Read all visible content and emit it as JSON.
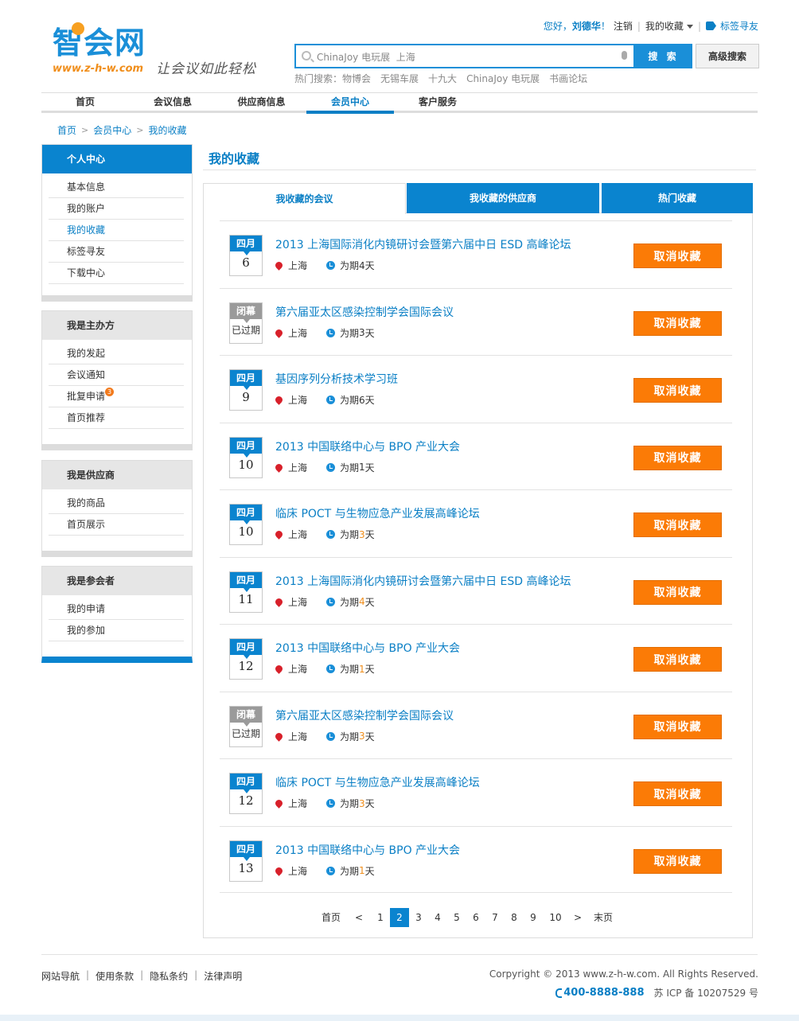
{
  "logo": {
    "name": "智会网",
    "url": "www.z-h-w.com",
    "slogan": "让会议如此轻松"
  },
  "toplinks": {
    "greeting": "您好，",
    "username": "刘德华",
    "exclaim": "！",
    "logout": "注销",
    "favorites": "我的收藏",
    "tag_find": "标签寻友"
  },
  "search": {
    "value": "ChinaJoy 电玩展  上海",
    "button": "搜 索",
    "advanced": "高级搜索",
    "hot_label": "热门搜索：",
    "hot": [
      "物博会",
      "无锡车展",
      "十九大",
      "ChinaJoy 电玩展",
      "书画论坛"
    ]
  },
  "nav": [
    "首页",
    "会议信息",
    "供应商信息",
    "会员中心",
    "客户服务"
  ],
  "breadcrumb": [
    "首页",
    "会员中心",
    "我的收藏"
  ],
  "sidebar": [
    {
      "title": "个人中心",
      "items": [
        "基本信息",
        "我的账户",
        "我的收藏",
        "标签寻友",
        "下载中心"
      ]
    },
    {
      "title": "我是主办方",
      "items": [
        "我的发起",
        "会议通知",
        "批复申请",
        "首页推荐"
      ],
      "badge": "3"
    },
    {
      "title": "我是供应商",
      "items": [
        "我的商品",
        "首页展示"
      ]
    },
    {
      "title": "我是参会者",
      "items": [
        "我的申请",
        "我的参加"
      ]
    }
  ],
  "page_title": "我的收藏",
  "tabs": [
    "我收藏的会议",
    "我收藏的供应商",
    "热门收藏"
  ],
  "cancel_label": "取消收藏",
  "meetings": [
    {
      "month": "四月",
      "day": "6",
      "title": "2013 上海国际消化内镜研讨会暨第六届中日 ESD 高峰论坛",
      "city": "上海",
      "dur_pre": "为期 ",
      "days": "4",
      "dur_post": " 天",
      "closed": false
    },
    {
      "month": "闭幕",
      "day": "已过期",
      "title": "第六届亚太区感染控制学会国际会议",
      "city": "上海",
      "dur_pre": "为期 ",
      "days": "3",
      "dur_post": " 天",
      "closed": true
    },
    {
      "month": "四月",
      "day": "9",
      "title": "基因序列分析技术学习班",
      "city": "上海",
      "dur_pre": "为期 ",
      "days": "6",
      "dur_post": " 天",
      "closed": false
    },
    {
      "month": "四月",
      "day": "10",
      "title": "2013 中国联络中心与 BPO 产业大会",
      "city": "上海",
      "dur_pre": "为期 ",
      "days": "1",
      "dur_post": " 天",
      "closed": false
    },
    {
      "month": "四月",
      "day": "10",
      "title": "临床 POCT 与生物应急产业发展高峰论坛",
      "city": "上海",
      "dur_pre": "为期 ",
      "days": "3",
      "dur_post": " 天",
      "closed": false,
      "hl": true
    },
    {
      "month": "四月",
      "day": "11",
      "title": "2013 上海国际消化内镜研讨会暨第六届中日 ESD 高峰论坛",
      "city": "上海",
      "dur_pre": "为期 ",
      "days": "4",
      "dur_post": " 天",
      "closed": false,
      "hl": true
    },
    {
      "month": "四月",
      "day": "12",
      "title": "2013 中国联络中心与 BPO 产业大会",
      "city": "上海",
      "dur_pre": "为期 ",
      "days": "1",
      "dur_post": " 天",
      "closed": false,
      "hl": true
    },
    {
      "month": "闭幕",
      "day": "已过期",
      "title": "第六届亚太区感染控制学会国际会议",
      "city": "上海",
      "dur_pre": "为期 ",
      "days": "3",
      "dur_post": " 天",
      "closed": true,
      "hl": true
    },
    {
      "month": "四月",
      "day": "12",
      "title": "临床 POCT 与生物应急产业发展高峰论坛",
      "city": "上海",
      "dur_pre": "为期 ",
      "days": "3",
      "dur_post": " 天",
      "closed": false,
      "hl": true
    },
    {
      "month": "四月",
      "day": "13",
      "title": "2013 中国联络中心与 BPO 产业大会",
      "city": "上海",
      "dur_pre": "为期 ",
      "days": "1",
      "dur_post": " 天",
      "closed": false,
      "hl": true
    }
  ],
  "pager": {
    "first": "首页",
    "prev": "<",
    "pages": [
      "1",
      "2",
      "3",
      "4",
      "5",
      "6",
      "7",
      "8",
      "9",
      "10"
    ],
    "current": "2",
    "next": ">",
    "last": "末页"
  },
  "footer": {
    "links": [
      "网站导航",
      "使用条款",
      "隐私条约",
      "法律声明"
    ],
    "copyright": "Corpyright © 2013 www.z-h-w.com. All Rights Reserved.",
    "phone": "400-8888-888",
    "icp": "苏 ICP 备 10207529 号"
  },
  "colors": {
    "brand": "#0a84cf",
    "accent": "#fb7b06"
  }
}
